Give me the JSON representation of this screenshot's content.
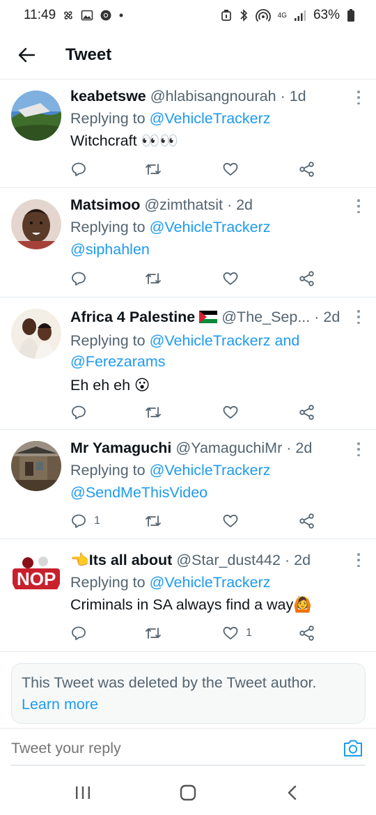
{
  "status_bar": {
    "time": "11:49",
    "battery": "63%",
    "network": "4G"
  },
  "header": {
    "title": "Tweet"
  },
  "tweets": [
    {
      "name": "keabetswe",
      "handle": "@hlabisangnourah",
      "time": "1d",
      "reply_prefix": "Replying to",
      "reply_targets": "@VehicleTrackerz",
      "text": "Witchcraft 👀👀",
      "text_link": "",
      "replies": "",
      "retweets": "",
      "likes": ""
    },
    {
      "name": "Matsimoo",
      "handle": "@zimthatsit",
      "time": "2d",
      "reply_prefix": "Replying to",
      "reply_targets": "@VehicleTrackerz",
      "text": "",
      "text_link": "@siphahlen",
      "replies": "",
      "retweets": "",
      "likes": ""
    },
    {
      "name": "Africa 4 Palestine",
      "flag": "🇵🇸",
      "handle": "@The_Sep...",
      "time": "2d",
      "reply_prefix": "Replying to",
      "reply_targets": "@VehicleTrackerz and",
      "reply_targets_2": "@Ferezarams",
      "text": "Eh eh eh 😮",
      "text_link": "",
      "replies": "",
      "retweets": "",
      "likes": ""
    },
    {
      "name": "Mr Yamaguchi",
      "handle": "@YamaguchiMr",
      "time": "2d",
      "reply_prefix": "Replying to",
      "reply_targets": "@VehicleTrackerz",
      "text": "",
      "text_link": "@SendMeThisVideo",
      "replies": "1",
      "retweets": "",
      "likes": ""
    },
    {
      "name": "Its all about",
      "name_prefix": "👈",
      "handle": "@Star_dust442",
      "time": "2d",
      "reply_prefix": "Replying to",
      "reply_targets": "@VehicleTrackerz",
      "text": "Criminals in SA always find a way🙆",
      "text_link": "",
      "replies": "",
      "retweets": "",
      "likes": "1"
    }
  ],
  "deleted_notice": {
    "text": "This Tweet was deleted by the Tweet author.",
    "link": "Learn more"
  },
  "reply_bar": {
    "placeholder": "Tweet your reply"
  },
  "colors": {
    "link": "#1d9bf0",
    "secondary": "#536471",
    "divider": "#e6ecf0"
  },
  "icons": [
    "back-arrow-icon",
    "more-icon",
    "reply-icon",
    "retweet-icon",
    "like-icon",
    "share-icon",
    "camera-icon",
    "recents-icon",
    "home-icon",
    "back-nav-icon"
  ]
}
